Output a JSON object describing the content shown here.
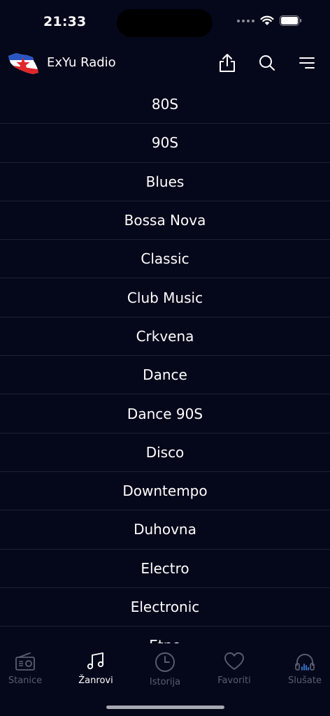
{
  "status": {
    "time": "21:33"
  },
  "header": {
    "title": "ExYu Radio"
  },
  "genres": [
    "80S",
    "90S",
    "Blues",
    "Bossa Nova",
    "Classic",
    "Club Music",
    "Crkvena",
    "Dance",
    "Dance 90S",
    "Disco",
    "Downtempo",
    "Duhovna",
    "Electro",
    "Electronic",
    "Etno"
  ],
  "tabs": [
    {
      "label": "Stanice",
      "icon": "radio-icon",
      "active": false
    },
    {
      "label": "Žanrovi",
      "icon": "music-note-icon",
      "active": true
    },
    {
      "label": "Istorija",
      "icon": "clock-icon",
      "active": false
    },
    {
      "label": "Favoriti",
      "icon": "heart-icon",
      "active": false
    },
    {
      "label": "Slušate",
      "icon": "headphones-icon",
      "active": false
    }
  ],
  "colors": {
    "background": "#05071a",
    "active_tab": "#ffffff",
    "inactive_tab": "#5a5e70",
    "accent": "#3a7bd5"
  }
}
